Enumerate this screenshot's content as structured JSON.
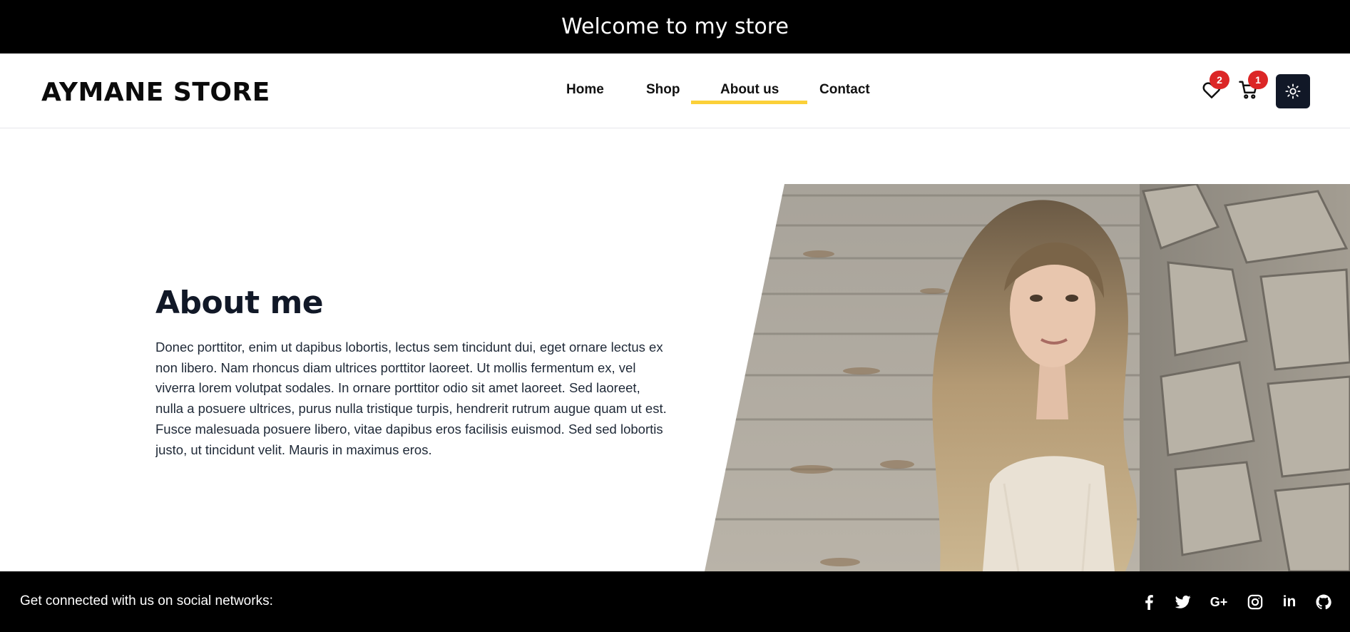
{
  "topbar": {
    "text": "Welcome to my store"
  },
  "header": {
    "brand": "AYMANE STORE",
    "nav": [
      {
        "label": "Home",
        "active": false
      },
      {
        "label": "Shop",
        "active": false
      },
      {
        "label": "About us",
        "active": true
      },
      {
        "label": "Contact",
        "active": false
      }
    ],
    "wishlist": {
      "icon": "heart-icon",
      "count": "2"
    },
    "cart": {
      "icon": "cart-icon",
      "count": "1"
    },
    "theme_toggle": {
      "icon": "sun-icon"
    },
    "accent_color": "#fbd038",
    "badge_color": "#dc2626"
  },
  "about": {
    "title": "About me",
    "text": "Donec porttitor, enim ut dapibus lobortis, lectus sem tincidunt dui, eget ornare lectus ex non libero. Nam rhoncus diam ultrices porttitor laoreet. Ut mollis fermentum ex, vel viverra lorem volutpat sodales. In ornare porttitor odio sit amet laoreet. Sed laoreet, nulla a posuere ultrices, purus nulla tristique turpis, hendrerit rutrum augue quam ut est. Fusce malesuada posuere libero, vitae dapibus eros facilisis euismod. Sed sed lobortis justo, ut tincidunt velit. Mauris in maximus eros."
  },
  "footer": {
    "text": "Get connected with us on social networks:",
    "social": [
      {
        "icon": "facebook-icon"
      },
      {
        "icon": "twitter-icon"
      },
      {
        "icon": "google-plus-icon",
        "glyph": "G+"
      },
      {
        "icon": "instagram-icon"
      },
      {
        "icon": "linkedin-icon",
        "glyph": "in"
      },
      {
        "icon": "github-icon"
      }
    ]
  }
}
